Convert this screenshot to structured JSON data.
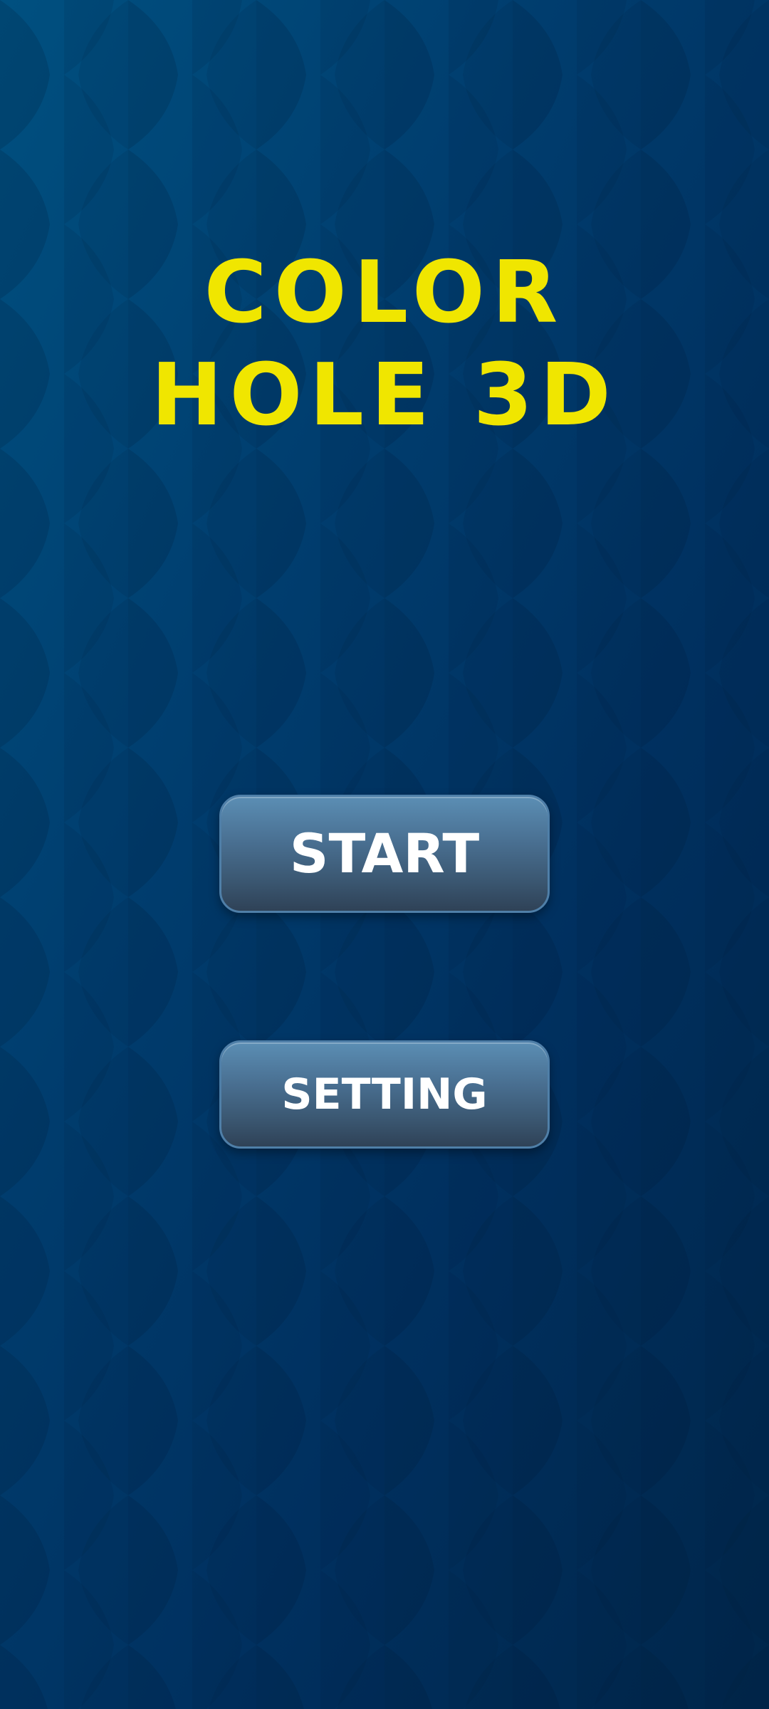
{
  "title": {
    "line1": "COLOR",
    "line2": "HOLE 3D",
    "color": "#f0e600"
  },
  "menu": {
    "start_label": "START",
    "setting_label": "SETTING"
  },
  "theme": {
    "background": "#003d6e",
    "button_top": "#5b8eb4",
    "button_bottom": "#2f4257",
    "button_text": "#ffffff"
  }
}
